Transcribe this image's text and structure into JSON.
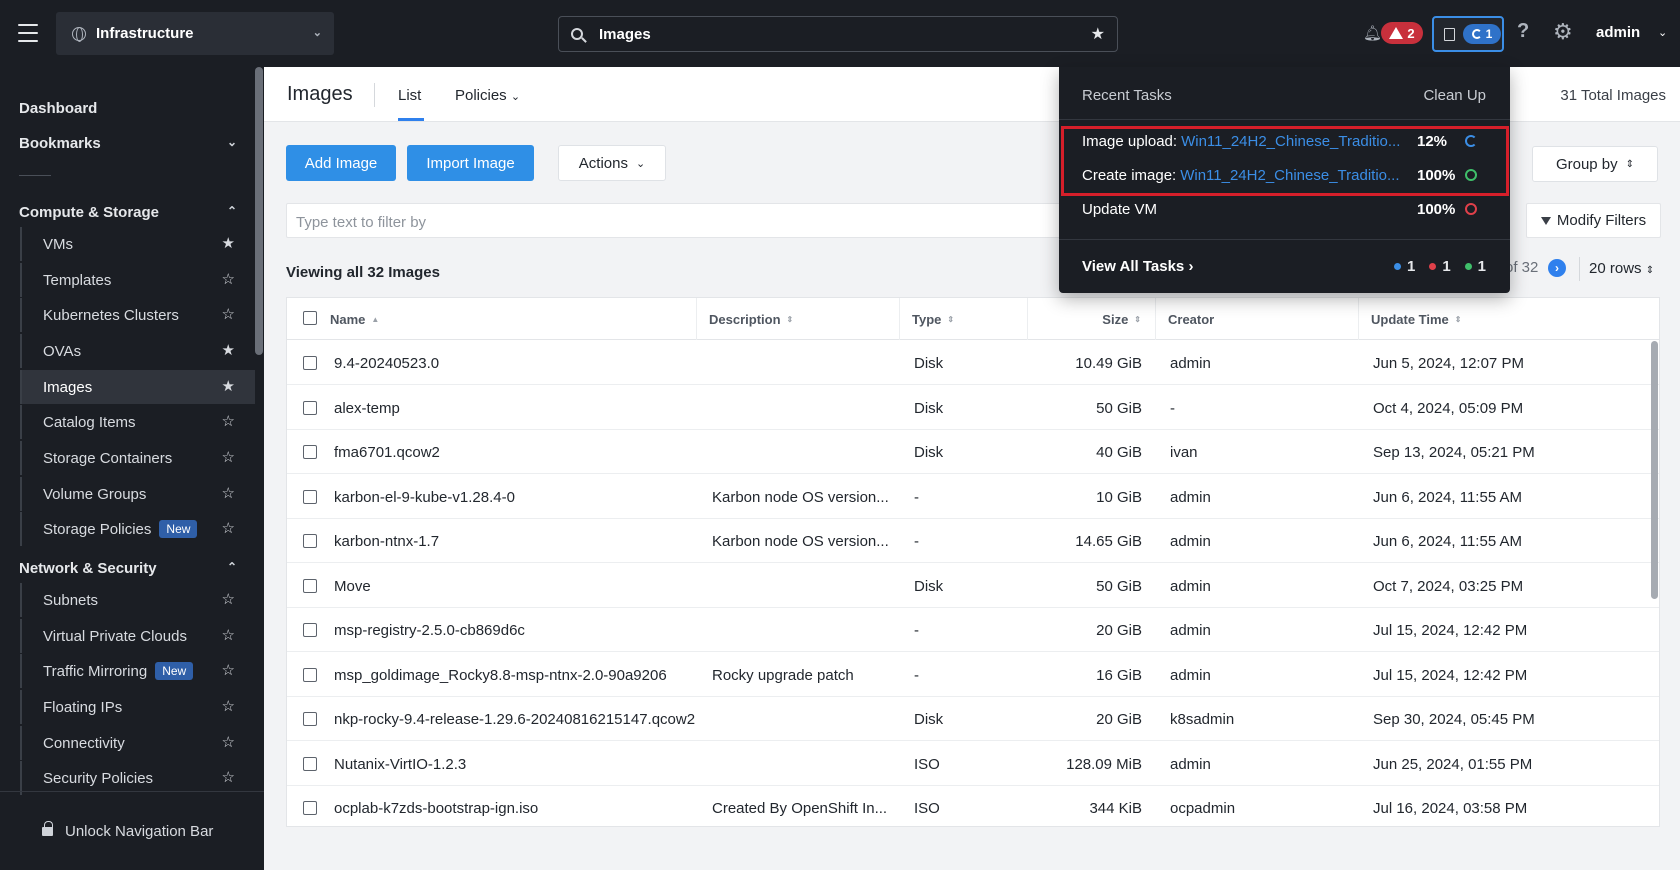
{
  "topbar": {
    "app_name": "Infrastructure",
    "search_value": "Images",
    "alerts_count": "2",
    "tasks_count": "1",
    "help": "?",
    "user": "admin"
  },
  "sidebar": {
    "dashboard": "Dashboard",
    "bookmarks": "Bookmarks",
    "sections": [
      {
        "title": "Compute & Storage",
        "items": [
          {
            "label": "VMs",
            "starred": true
          },
          {
            "label": "Templates",
            "starred": false
          },
          {
            "label": "Kubernetes Clusters",
            "starred": false
          },
          {
            "label": "OVAs",
            "starred": true
          },
          {
            "label": "Images",
            "starred": true,
            "active": true
          },
          {
            "label": "Catalog Items",
            "starred": false
          },
          {
            "label": "Storage Containers",
            "starred": false
          },
          {
            "label": "Volume Groups",
            "starred": false
          },
          {
            "label": "Storage Policies",
            "starred": false,
            "badge": "New"
          }
        ]
      },
      {
        "title": "Network & Security",
        "items": [
          {
            "label": "Subnets",
            "starred": false
          },
          {
            "label": "Virtual Private Clouds",
            "starred": false
          },
          {
            "label": "Traffic Mirroring",
            "starred": false,
            "badge": "New"
          },
          {
            "label": "Floating IPs",
            "starred": false
          },
          {
            "label": "Connectivity",
            "starred": false
          },
          {
            "label": "Security Policies",
            "starred": false
          }
        ]
      }
    ],
    "unlock": "Unlock Navigation Bar"
  },
  "header": {
    "title": "Images",
    "tab_list": "List",
    "tab_policies": "Policies",
    "total": "31 Total Images"
  },
  "toolbar": {
    "add_image": "Add Image",
    "import_image": "Import Image",
    "actions": "Actions",
    "group_by": "Group by",
    "filter_placeholder": "Type text to filter by",
    "modify_filters": "Modify Filters"
  },
  "listing": {
    "viewing": "Viewing all 32 Images",
    "pager_of": "of 32",
    "rows": "20 rows"
  },
  "table": {
    "columns": [
      "Name",
      "Description",
      "Type",
      "Size",
      "Creator",
      "Update Time"
    ],
    "rows": [
      {
        "name": "9.4-20240523.0",
        "description": "",
        "type": "Disk",
        "size": "10.49 GiB",
        "creator": "admin",
        "updated": "Jun 5, 2024, 12:07 PM"
      },
      {
        "name": "alex-temp",
        "description": "",
        "type": "Disk",
        "size": "50 GiB",
        "creator": "-",
        "updated": "Oct 4, 2024, 05:09 PM"
      },
      {
        "name": "fma6701.qcow2",
        "description": "",
        "type": "Disk",
        "size": "40 GiB",
        "creator": "ivan",
        "updated": "Sep 13, 2024, 05:21 PM"
      },
      {
        "name": "karbon-el-9-kube-v1.28.4-0",
        "description": "Karbon node OS version...",
        "type": "-",
        "size": "10 GiB",
        "creator": "admin",
        "updated": "Jun 6, 2024, 11:55 AM"
      },
      {
        "name": "karbon-ntnx-1.7",
        "description": "Karbon node OS version...",
        "type": "-",
        "size": "14.65 GiB",
        "creator": "admin",
        "updated": "Jun 6, 2024, 11:55 AM"
      },
      {
        "name": "Move",
        "description": "",
        "type": "Disk",
        "size": "50 GiB",
        "creator": "admin",
        "updated": "Oct 7, 2024, 03:25 PM"
      },
      {
        "name": "msp-registry-2.5.0-cb869d6c",
        "description": "",
        "type": "-",
        "size": "20 GiB",
        "creator": "admin",
        "updated": "Jul 15, 2024, 12:42 PM"
      },
      {
        "name": "msp_goldimage_Rocky8.8-msp-ntnx-2.0-90a9206",
        "description": "Rocky upgrade patch",
        "type": "-",
        "size": "16 GiB",
        "creator": "admin",
        "updated": "Jul 15, 2024, 12:42 PM"
      },
      {
        "name": "nkp-rocky-9.4-release-1.29.6-20240816215147.qcow2",
        "description": "",
        "type": "Disk",
        "size": "20 GiB",
        "creator": "k8sadmin",
        "updated": "Sep 30, 2024, 05:45 PM"
      },
      {
        "name": "Nutanix-VirtIO-1.2.3",
        "description": "",
        "type": "ISO",
        "size": "128.09 MiB",
        "creator": "admin",
        "updated": "Jun 25, 2024, 01:55 PM"
      },
      {
        "name": "ocplab-k7zds-bootstrap-ign.iso",
        "description": "Created By OpenShift In...",
        "type": "ISO",
        "size": "344 KiB",
        "creator": "ocpadmin",
        "updated": "Jul 16, 2024, 03:58 PM"
      }
    ]
  },
  "tasks_panel": {
    "title": "Recent Tasks",
    "clean_up": "Clean Up",
    "tasks": [
      {
        "label": "Image upload:",
        "link": "Win11_24H2_Chinese_Traditio...",
        "percent": "12%",
        "status": "running"
      },
      {
        "label": "Create image:",
        "link": "Win11_24H2_Chinese_Traditio...",
        "percent": "100%",
        "status": "succeeded"
      },
      {
        "label": "Update VM",
        "link": "",
        "percent": "100%",
        "status": "failed"
      }
    ],
    "view_all": "View All Tasks",
    "counts": {
      "running": "1",
      "failed": "1",
      "succeeded": "1"
    }
  },
  "colors": {
    "primary": "#2f8fe6",
    "topbar_bg": "#1b1e24",
    "highlight": "#d61f2a",
    "running": "#3b8ee6",
    "success": "#3fbf6a",
    "failed": "#e0404a"
  }
}
